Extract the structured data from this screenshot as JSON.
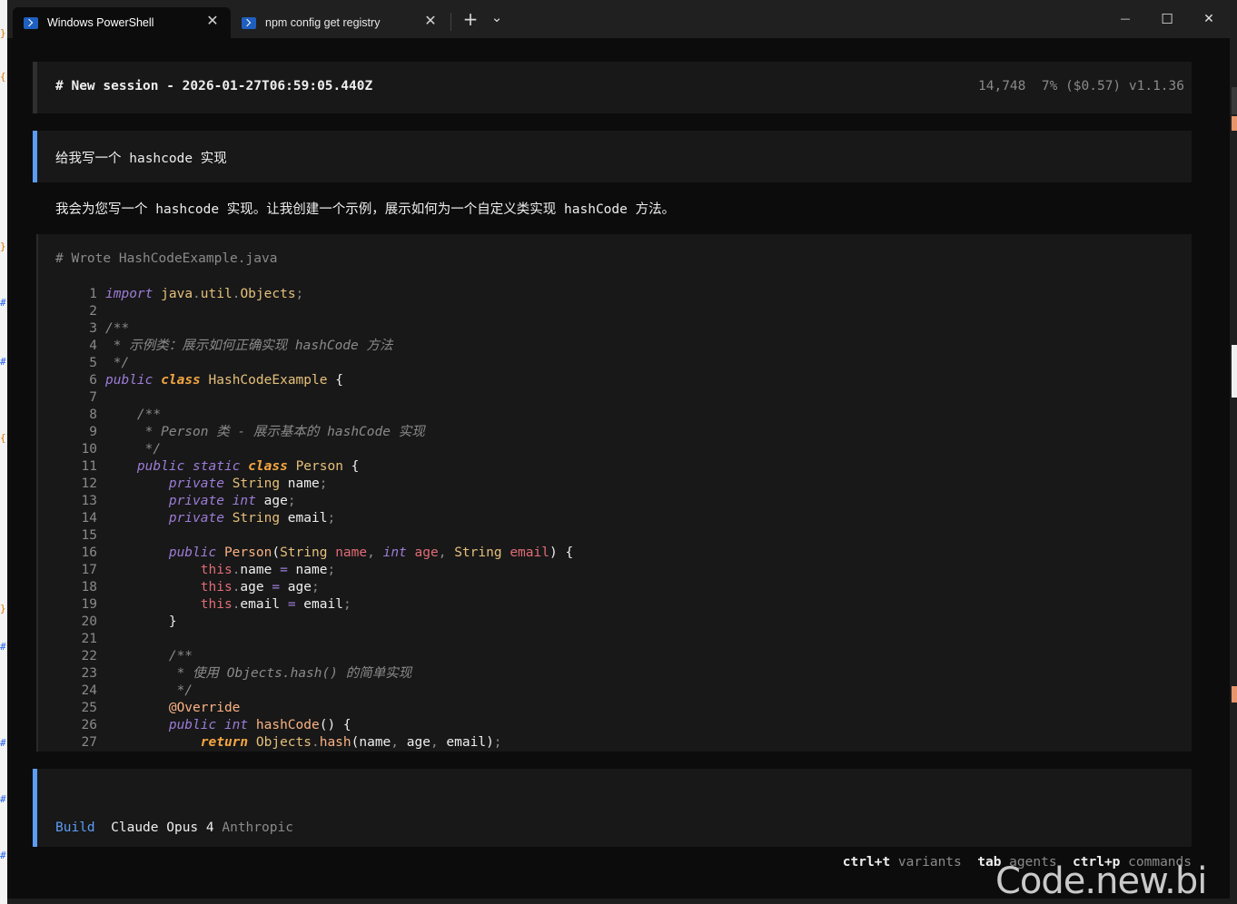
{
  "window": {
    "tabs": [
      {
        "title": "Windows PowerShell",
        "active": true
      },
      {
        "title": "npm config get registry",
        "active": false
      }
    ],
    "new_tab_label": "+",
    "dropdown_label": "⌄",
    "minimize_label": "—",
    "maximize_label": "☐",
    "close_label": "✕",
    "tab_close_label": "✕"
  },
  "session": {
    "title": "# New session - 2026-01-27T06:59:05.440Z",
    "stats": "14,748  7% ($0.57) v1.1.36"
  },
  "user_message": "给我写一个 hashcode 实现",
  "assistant_message": "我会为您写一个 hashcode 实现。让我创建一个示例，展示如何为一个自定义类实现 hashCode 方法。",
  "code_block": {
    "header": "# Wrote HashCodeExample.java",
    "line_numbers": [
      "1",
      "2",
      "3",
      "4",
      "5",
      "6",
      "7",
      "8",
      "9",
      "10",
      "11",
      "12",
      "13",
      "14",
      "15",
      "16",
      "17",
      "18",
      "19",
      "20",
      "21",
      "22",
      "23",
      "24",
      "25",
      "26",
      "27"
    ],
    "lines": [
      [
        [
          "k",
          "import"
        ],
        [
          "tx",
          " "
        ],
        [
          "ty",
          "java"
        ],
        [
          "pn",
          "."
        ],
        [
          "ty",
          "util"
        ],
        [
          "pn",
          "."
        ],
        [
          "ty",
          "Objects"
        ],
        [
          "pn",
          ";"
        ]
      ],
      [],
      [
        [
          "cm",
          "/**"
        ]
      ],
      [
        [
          "cm",
          " * 示例类：展示如何正确实现 hashCode 方法"
        ]
      ],
      [
        [
          "cm",
          " */"
        ]
      ],
      [
        [
          "k",
          "public"
        ],
        [
          "tx",
          " "
        ],
        [
          "kb",
          "class"
        ],
        [
          "tx",
          " "
        ],
        [
          "ty",
          "HashCodeExample"
        ],
        [
          "tx",
          " {"
        ]
      ],
      [],
      [
        [
          "cm",
          "    /**"
        ]
      ],
      [
        [
          "cm",
          "     * Person 类 - 展示基本的 hashCode 实现"
        ]
      ],
      [
        [
          "cm",
          "     */"
        ]
      ],
      [
        [
          "k",
          "    public"
        ],
        [
          "tx",
          " "
        ],
        [
          "k",
          "static"
        ],
        [
          "tx",
          " "
        ],
        [
          "kb",
          "class"
        ],
        [
          "tx",
          " "
        ],
        [
          "ty",
          "Person"
        ],
        [
          "tx",
          " {"
        ]
      ],
      [
        [
          "k",
          "        private"
        ],
        [
          "tx",
          " "
        ],
        [
          "ty",
          "String"
        ],
        [
          "tx",
          " name"
        ],
        [
          "pn",
          ";"
        ]
      ],
      [
        [
          "k",
          "        private"
        ],
        [
          "tx",
          " "
        ],
        [
          "k",
          "int"
        ],
        [
          "tx",
          " age"
        ],
        [
          "pn",
          ";"
        ]
      ],
      [
        [
          "k",
          "        private"
        ],
        [
          "tx",
          " "
        ],
        [
          "ty",
          "String"
        ],
        [
          "tx",
          " email"
        ],
        [
          "pn",
          ";"
        ]
      ],
      [],
      [
        [
          "k",
          "        public"
        ],
        [
          "tx",
          " "
        ],
        [
          "fn",
          "Person"
        ],
        [
          "tx",
          "("
        ],
        [
          "ty",
          "String"
        ],
        [
          "tx",
          " "
        ],
        [
          "vr",
          "name"
        ],
        [
          "pn",
          ","
        ],
        [
          "tx",
          " "
        ],
        [
          "k",
          "int"
        ],
        [
          "tx",
          " "
        ],
        [
          "vr",
          "age"
        ],
        [
          "pn",
          ","
        ],
        [
          "tx",
          " "
        ],
        [
          "ty",
          "String"
        ],
        [
          "tx",
          " "
        ],
        [
          "vr",
          "email"
        ],
        [
          "tx",
          ") {"
        ]
      ],
      [
        [
          "vr",
          "            this"
        ],
        [
          "pn",
          "."
        ],
        [
          "tx",
          "name "
        ],
        [
          "k",
          "="
        ],
        [
          "tx",
          " name"
        ],
        [
          "pn",
          ";"
        ]
      ],
      [
        [
          "vr",
          "            this"
        ],
        [
          "pn",
          "."
        ],
        [
          "tx",
          "age "
        ],
        [
          "k",
          "="
        ],
        [
          "tx",
          " age"
        ],
        [
          "pn",
          ";"
        ]
      ],
      [
        [
          "vr",
          "            this"
        ],
        [
          "pn",
          "."
        ],
        [
          "tx",
          "email "
        ],
        [
          "k",
          "="
        ],
        [
          "tx",
          " email"
        ],
        [
          "pn",
          ";"
        ]
      ],
      [
        [
          "tx",
          "        }"
        ]
      ],
      [],
      [
        [
          "cm",
          "        /**"
        ]
      ],
      [
        [
          "cm",
          "         * 使用 Objects.hash() 的简单实现"
        ]
      ],
      [
        [
          "cm",
          "         */"
        ]
      ],
      [
        [
          "fn",
          "        @Override"
        ]
      ],
      [
        [
          "k",
          "        public"
        ],
        [
          "tx",
          " "
        ],
        [
          "k",
          "int"
        ],
        [
          "tx",
          " "
        ],
        [
          "fn",
          "hashCode"
        ],
        [
          "tx",
          "() {"
        ]
      ],
      [
        [
          "kb",
          "            return"
        ],
        [
          "tx",
          " "
        ],
        [
          "ty",
          "Objects"
        ],
        [
          "pn",
          "."
        ],
        [
          "fn",
          "hash"
        ],
        [
          "tx",
          "(name"
        ],
        [
          "pn",
          ","
        ],
        [
          "tx",
          " age"
        ],
        [
          "pn",
          ","
        ],
        [
          "tx",
          " email)"
        ],
        [
          "pn",
          ";"
        ]
      ]
    ]
  },
  "input": {
    "agent": "Build",
    "model": "Claude Opus 4",
    "provider": "Anthropic"
  },
  "hints": [
    {
      "key": "ctrl+t",
      "desc": "variants"
    },
    {
      "key": "tab",
      "desc": "agents"
    },
    {
      "key": "ctrl+p",
      "desc": "commands"
    }
  ],
  "watermark": "Code.new.bi",
  "colors": {
    "accent_blue": "#5c9cf5",
    "background": "#0c0c0c",
    "panel": "#181818"
  }
}
